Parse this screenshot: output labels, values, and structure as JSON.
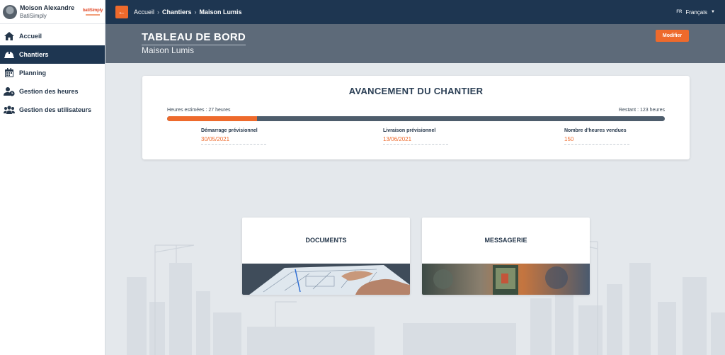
{
  "user": {
    "name": "Moison Alexandre",
    "company": "BatiSimply",
    "logo_text": "batiSimply"
  },
  "sidebar": {
    "items": [
      {
        "label": "Accueil",
        "icon": "home-icon",
        "active": false
      },
      {
        "label": "Chantiers",
        "icon": "hard-hat-icon",
        "active": true
      },
      {
        "label": "Planning",
        "icon": "calendar-icon",
        "active": false
      },
      {
        "label": "Gestion des heures",
        "icon": "user-clock-icon",
        "active": false
      },
      {
        "label": "Gestion des utilisateurs",
        "icon": "users-icon",
        "active": false
      }
    ]
  },
  "topbar": {
    "breadcrumb": [
      "Accueil",
      "Chantiers",
      "Maison Lumis"
    ],
    "lang_code": "FR",
    "lang_label": "Français"
  },
  "header": {
    "title": "TABLEAU DE BORD",
    "subtitle": "Maison Lumis",
    "modify_label": "Modifier"
  },
  "progress": {
    "title": "AVANCEMENT DU CHANTIER",
    "estimated_label": "Heures estimées : 27 heures",
    "remaining_label": "Restant : 123 heures",
    "fraction": 0.18,
    "fields": [
      {
        "label": "Démarrage prévisionnel",
        "value": "30/05/2021"
      },
      {
        "label": "Livraison prévisionnel",
        "value": "13/06/2021"
      },
      {
        "label": "Nombre d'heures vendues",
        "value": "150"
      }
    ]
  },
  "modules": [
    {
      "title": "DOCUMENTS"
    },
    {
      "title": "MESSAGERIE"
    }
  ],
  "colors": {
    "accent": "#ee6a2c",
    "navy": "#1e3651",
    "band": "#5d6a79"
  }
}
